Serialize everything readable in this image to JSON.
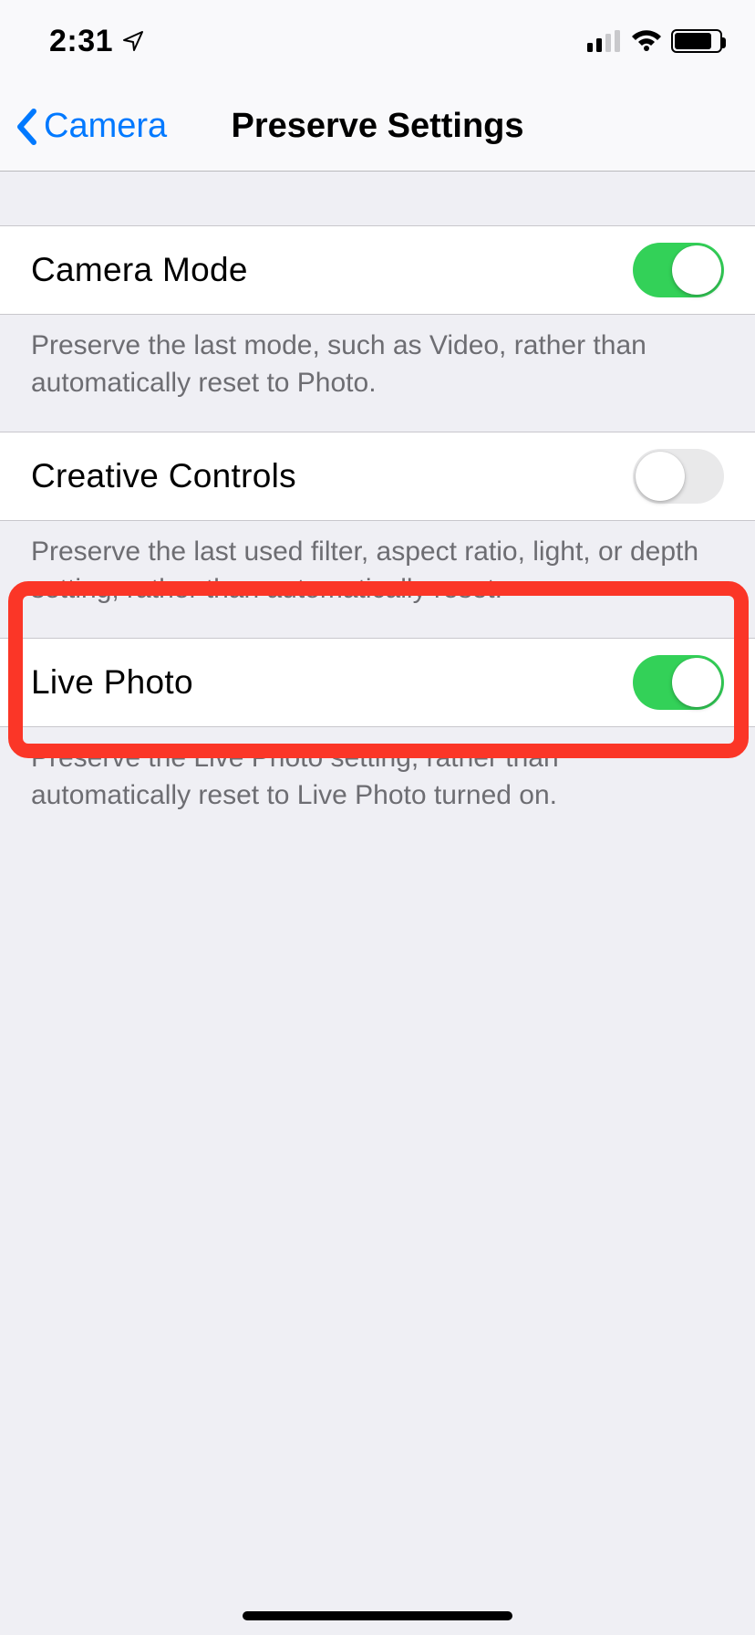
{
  "status": {
    "time": "2:31"
  },
  "nav": {
    "back_label": "Camera",
    "title": "Preserve Settings"
  },
  "settings": [
    {
      "label": "Camera Mode",
      "on": true,
      "description": "Preserve the last mode, such as Video, rather than automatically reset to Photo.",
      "highlighted": false
    },
    {
      "label": "Creative Controls",
      "on": false,
      "description": "Preserve the last used filter, aspect ratio, light, or depth setting, rather than automatically reset.",
      "highlighted": false
    },
    {
      "label": "Live Photo",
      "on": true,
      "description": "Preserve the Live Photo setting, rather than automatically reset to Live Photo turned on.",
      "highlighted": true
    }
  ],
  "colors": {
    "accent": "#0079ff",
    "switch_on": "#33d158",
    "highlight": "#fb3627"
  }
}
